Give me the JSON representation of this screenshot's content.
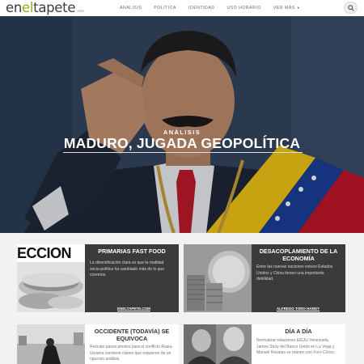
{
  "header": {
    "logo_en": "en",
    "logo_el": "el",
    "logo_tapete": "tapete",
    "logo_suffix": ".com",
    "menu": [
      "ANÁLISIS",
      "POLÍTICA",
      "IDENTIDAD",
      "USO HORARIO",
      "VER MÁS"
    ],
    "search_icon": "search-icon"
  },
  "hero": {
    "kicker": "ANÁLISIS",
    "title": "MADURO, JUGADA GEOPOLÍTICA"
  },
  "cards": [
    {
      "title": "PRIMARIAS FAST FOOD",
      "image_text": "ECCION",
      "excerpt": "La diversificación clara es que la realidad socio-política ha cambiado más de lo que creemos.",
      "author": "ENELTAPETE.COM"
    },
    {
      "title": "DESACOPLAMIENTO DE LA ECONOMÍA",
      "excerpt": "Entre las nuevas naciones estuvo Estados Unidos y China tienen una importante debilidad.",
      "author": "ALFREDO TORO HARDY"
    },
    {
      "title": "OCCIDENTE (TODAVÍA) SE EQUIVOCA",
      "excerpt": "Rescate pasos previos para el conflicto Rusia-Ucrania conviene claves que requieren de un riguroso análisis."
    },
    {
      "title": "DÍA A DÍA",
      "excerpt": "Normalizar relaciones EEUU-Venezuela, James Story del Banco Unido en La Vega y Manuel Rosales se reúnen con Foro Cívico."
    }
  ]
}
